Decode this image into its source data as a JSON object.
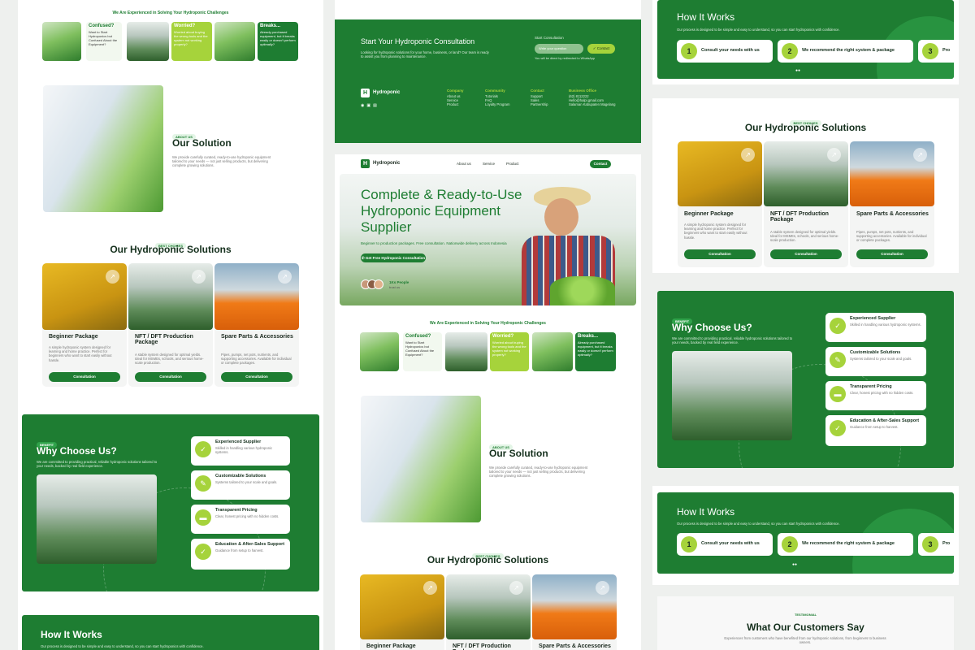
{
  "colors": {
    "primary": "#1e7d32",
    "accent": "#a6d33b",
    "light": "#e3f5e6"
  },
  "brand": {
    "name": "Hydroponic",
    "logo_letter": "H"
  },
  "nav": {
    "about": "About us",
    "service": "Service",
    "product": "Product",
    "contact_button": "Contact"
  },
  "hero": {
    "title": "Complete & Ready-to-Use Hydroponic Equipment Supplier",
    "subtitle": "Beginner to production packages. Free consultation. Nationwide delivery across Indonesia",
    "cta": "Get Free Hydroponic Consultation",
    "trust_count": "1Ks People",
    "trust_text": "trust us"
  },
  "challenges": {
    "heading": "We Are Experienced in Solving Your Hydroponic Challenges",
    "confused_title": "Confused?",
    "confused_text": "Want to Start Hydroponics but Confused About the Equipment?",
    "worried_title": "Worried?",
    "worried_text": "Worried about buying the wrong tools and the system not working properly?",
    "breaks_title": "Breaks...",
    "breaks_text": "Already purchased equipment, but it breaks easily or doesn't perform optimally?"
  },
  "solution": {
    "label": "ABOUT US",
    "title": "Our Solution",
    "text": "We provide carefully curated, ready-to-use hydroponic equipment tailored to your needs — not just selling products, but delivering complete growing solutions."
  },
  "products": {
    "label": "BEST CHOICES",
    "title": "Our Hydroponic Solutions",
    "button": "Consultation",
    "items": [
      {
        "name": "Beginner Package",
        "desc": "A simple hydroponic system designed for learning and home practice. Perfect for beginners who want to start easily without hassle."
      },
      {
        "name": "NFT / DFT Production Package",
        "desc": "A stable system designed for optimal yields. Ideal for MSMEs, schools, and serious home-scale production."
      },
      {
        "name": "Spare Parts & Accessories",
        "desc": "Pipes, pumps, net pots, nutrients, and supporting accessories. Available for individual or complete packages."
      }
    ]
  },
  "why": {
    "label": "BENEFIT",
    "title": "Why Choose Us?",
    "text": "We are committed to providing practical, reliable hydroponic solutions tailored to your needs, backed by real field experience.",
    "items": [
      {
        "title": "Experienced Supplier",
        "text": "Skilled in handling various hydroponic systems.",
        "icon": "✓"
      },
      {
        "title": "Customizable Solutions",
        "text": "Systems tailored to your scale and goals.",
        "icon": "✎"
      },
      {
        "title": "Transparent Pricing",
        "text": "Clear, honest pricing with no hidden costs.",
        "icon": "▬"
      },
      {
        "title": "Education & After-Sales Support",
        "text": "Guidance from setup to harvest.",
        "icon": "✓"
      }
    ]
  },
  "how": {
    "title": "How It Works",
    "text": "Our process is designed to be simple and easy to understand, so you can start hydroponics with confidence.",
    "steps": [
      {
        "num": "1",
        "text": "Consult your needs with us"
      },
      {
        "num": "2",
        "text": "We recommend the right system & package"
      },
      {
        "num": "3",
        "text": "Pro"
      }
    ]
  },
  "consult": {
    "title": "Start Your Hydroponic Consultation",
    "text": "Looking for hydroponic solutions for your home, business, or land? Our team is ready to assist you from planning to maintenance.",
    "form_label": "Start Consultation",
    "placeholder": "Write your question",
    "button": "Contact",
    "note": "You will be direct by redirected to WhatsApp"
  },
  "footer": {
    "company": "Company",
    "company_links": [
      "About us",
      "Service",
      "Product"
    ],
    "community": "Community",
    "community_links": [
      "Tutorials",
      "FAQ",
      "Loyalty Program"
    ],
    "contact": "Contact",
    "contact_links": [
      "Support",
      "Sales",
      "Partnership"
    ],
    "office": "Business Office",
    "office_lines": [
      "(62) 8112222",
      "Hello@halpi.gmail.com",
      "Salaman Kabupaten Magelang"
    ]
  },
  "testimonial": {
    "label": "TESTIMONIAL",
    "title": "What Our Customers Say",
    "text": "Experiences from customers who have benefited from our hydroponic solutions, from beginners to business owners."
  }
}
